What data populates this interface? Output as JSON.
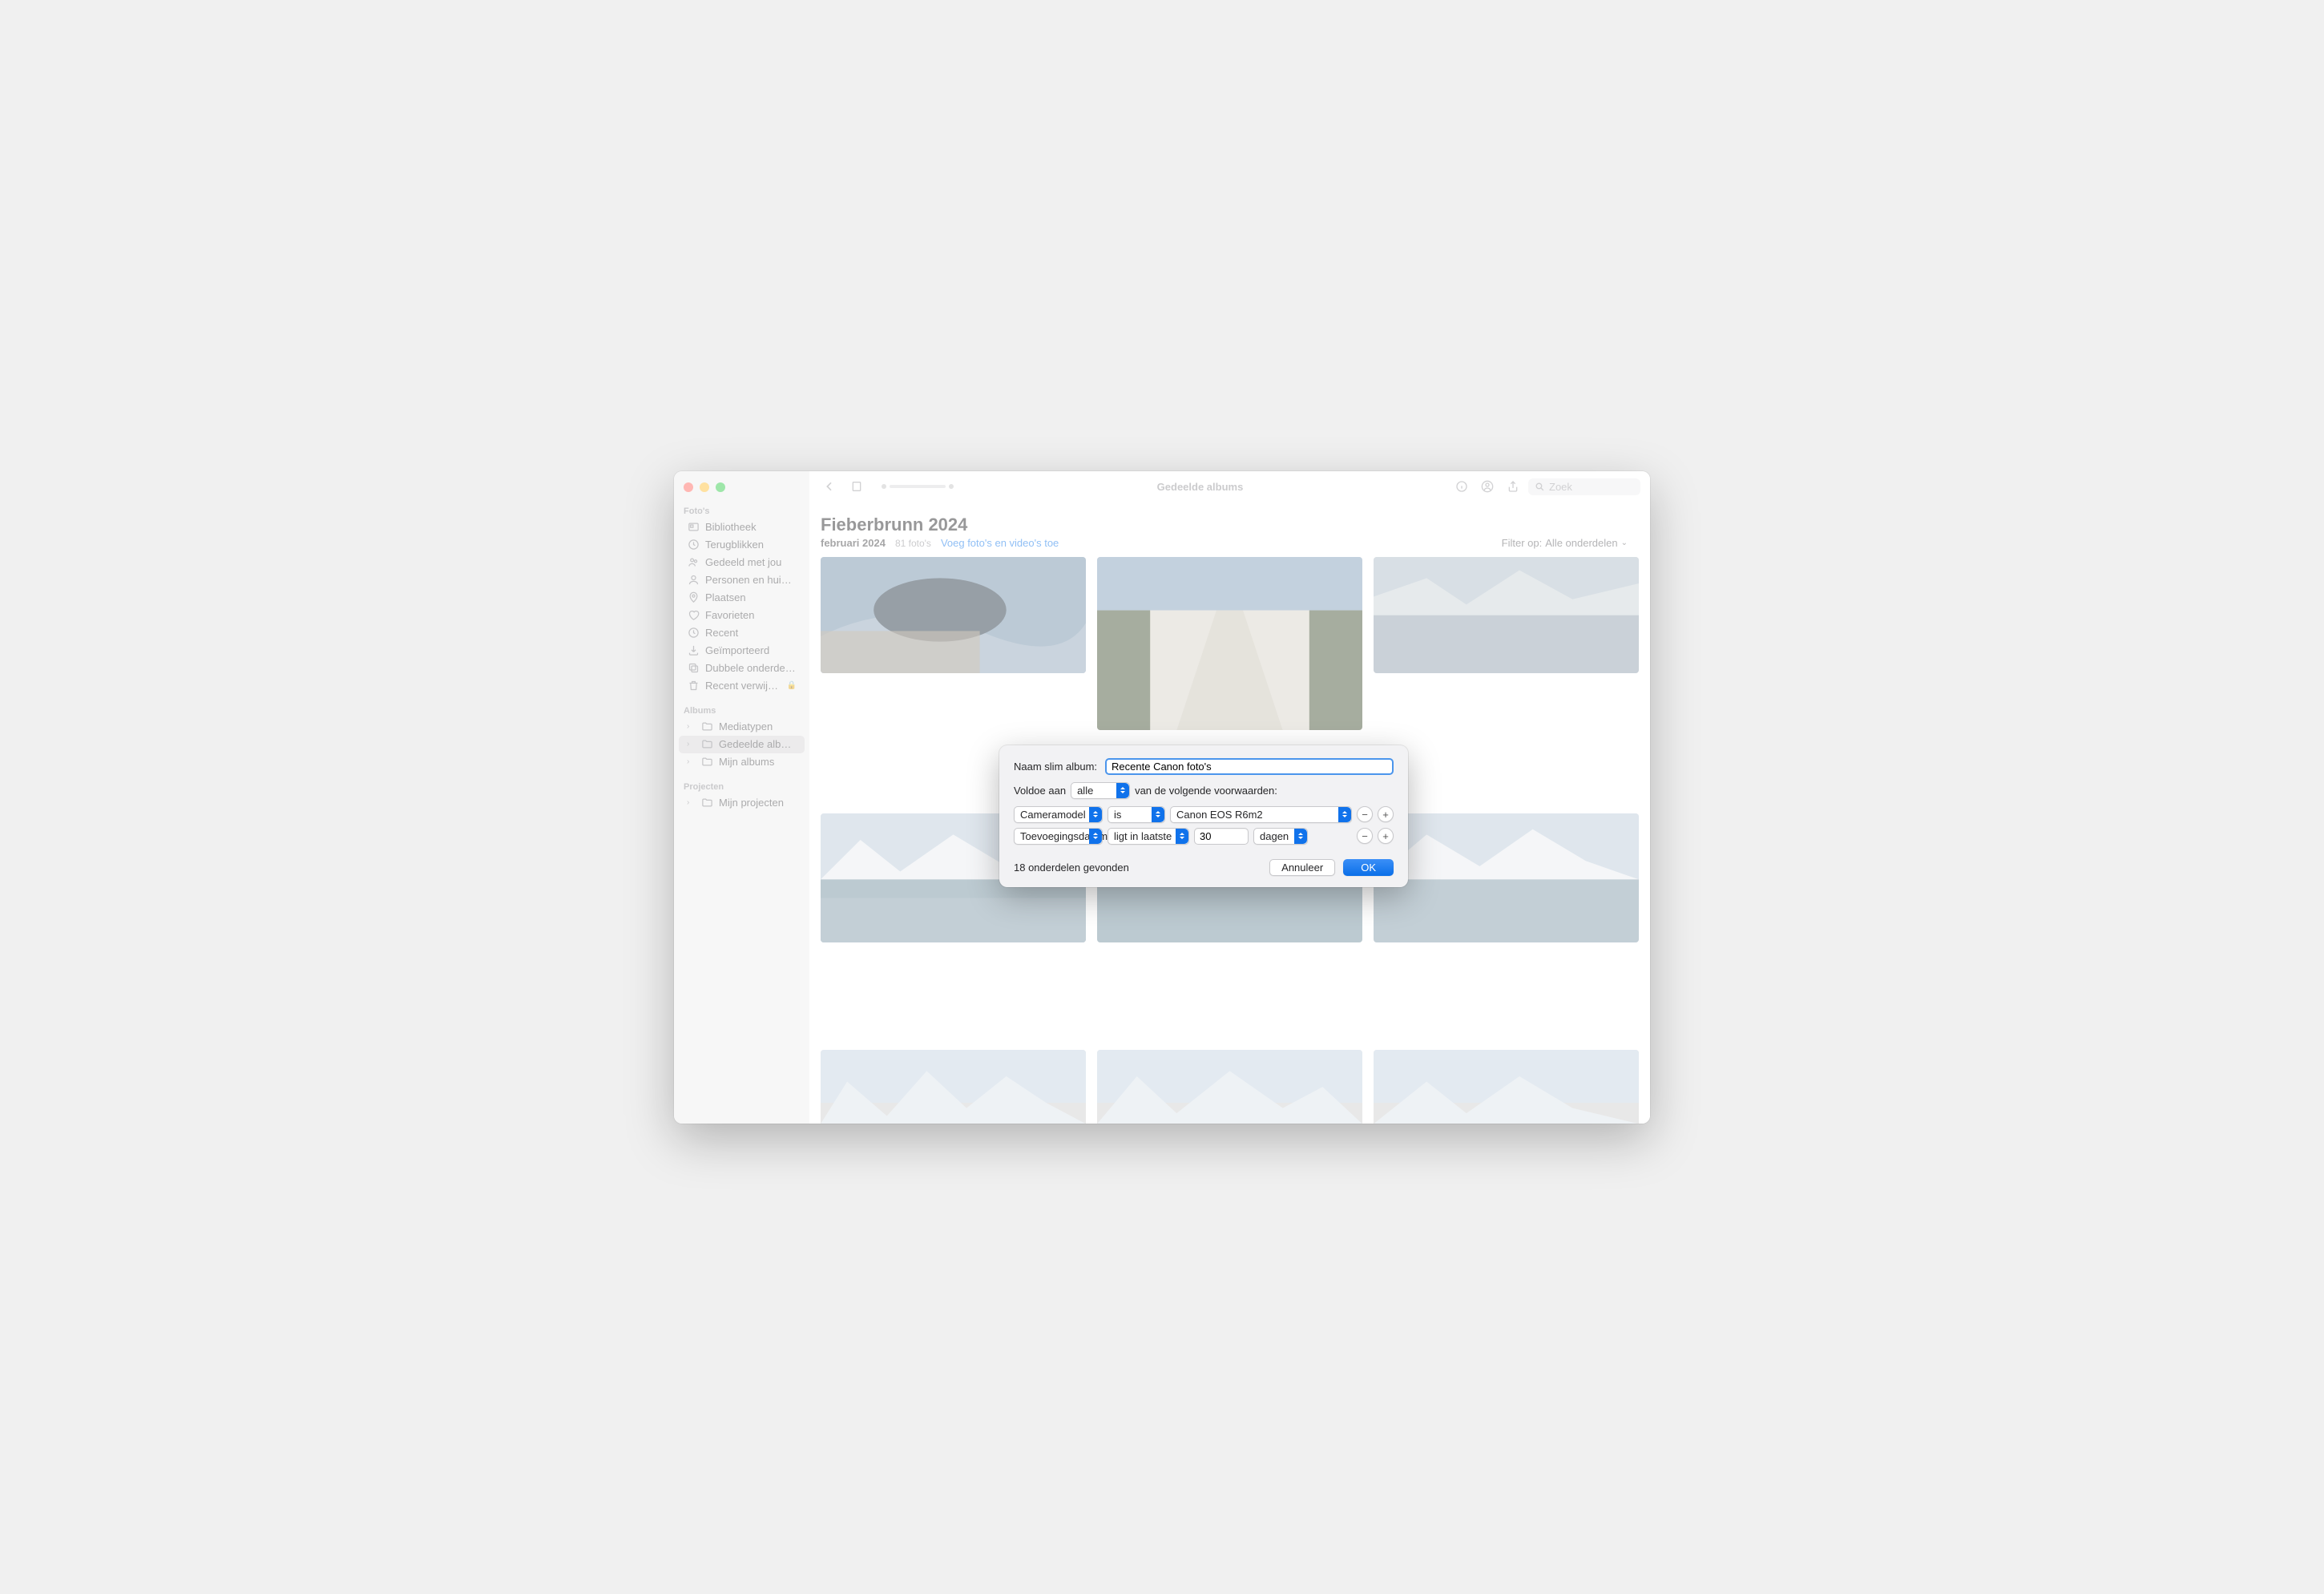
{
  "toolbar": {
    "center_title": "Gedeelde albums",
    "search_placeholder": "Zoek"
  },
  "sidebar": {
    "sections": {
      "fotos": {
        "title": "Foto's"
      },
      "albums": {
        "title": "Albums"
      },
      "projecten": {
        "title": "Projecten"
      }
    },
    "items": {
      "bibliotheek": "Bibliotheek",
      "terugblikken": "Terugblikken",
      "gedeeld_met_jou": "Gedeeld met jou",
      "personen": "Personen en huisdieren",
      "plaatsen": "Plaatsen",
      "favorieten": "Favorieten",
      "recent": "Recent",
      "geimporteerd": "Geïmporteerd",
      "dubbele": "Dubbele onderdelen",
      "verwijderd": "Recent verwijderd",
      "mediatypen": "Mediatypen",
      "gedeelde_albums": "Gedeelde albums",
      "mijn_albums": "Mijn albums",
      "mijn_projecten": "Mijn projecten"
    }
  },
  "album": {
    "title": "Fieberbrunn 2024",
    "date": "februari 2024",
    "count": "81 foto's",
    "add_link": "Voeg foto's en video's toe",
    "filter_label": "Filter op:",
    "filter_value": "Alle onderdelen"
  },
  "dialog": {
    "name_label": "Naam slim album:",
    "name_value": "Recente Canon foto's",
    "match_prefix": "Voldoe aan",
    "match_mode": "alle",
    "match_suffix": "van de volgende voorwaarden:",
    "rule1": {
      "field": "Cameramodel",
      "op": "is",
      "value": "Canon EOS R6m2"
    },
    "rule2": {
      "field": "Toevoegingsdatum",
      "op": "ligt in laatste",
      "value": "30",
      "unit": "dagen"
    },
    "found": "18 onderdelen gevonden",
    "cancel": "Annuleer",
    "ok": "OK"
  }
}
